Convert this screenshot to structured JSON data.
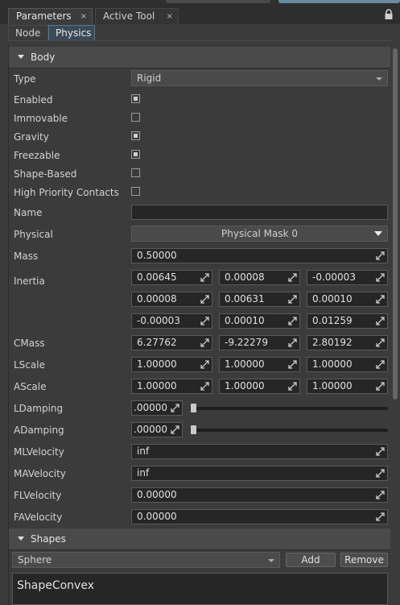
{
  "window": {
    "tabs": [
      {
        "label": "Parameters",
        "close": "×"
      },
      {
        "label": "Active Tool",
        "close": "×"
      }
    ],
    "lock_icon": "lock-icon"
  },
  "subtabs": [
    "Node",
    "Physics"
  ],
  "body_section": {
    "title": "Body",
    "type_label": "Type",
    "type_value": "Rigid",
    "checks": [
      {
        "label": "Enabled",
        "checked": true
      },
      {
        "label": "Immovable",
        "checked": false
      },
      {
        "label": "Gravity",
        "checked": true
      },
      {
        "label": "Freezable",
        "checked": true
      },
      {
        "label": "Shape-Based",
        "checked": false
      },
      {
        "label": "High Priority Contacts",
        "checked": false
      }
    ],
    "name_label": "Name",
    "name_value": "",
    "physical_label": "Physical",
    "physical_value": "Physical Mask 0",
    "mass_label": "Mass",
    "mass_value": "0.50000",
    "inertia_label": "Inertia",
    "inertia": [
      [
        "0.00645",
        "0.00008",
        "-0.00003"
      ],
      [
        "0.00008",
        "0.00631",
        "0.00010"
      ],
      [
        "-0.00003",
        "0.00010",
        "0.01259"
      ]
    ],
    "cmass_label": "CMass",
    "cmass": [
      "6.27762",
      "-9.22279",
      "2.80192"
    ],
    "lscale_label": "LScale",
    "lscale": [
      "1.00000",
      "1.00000",
      "1.00000"
    ],
    "ascale_label": "AScale",
    "ascale": [
      "1.00000",
      "1.00000",
      "1.00000"
    ],
    "ldamping_label": "LDamping",
    "ldamping_value": ".00000",
    "adamping_label": "ADamping",
    "adamping_value": ".00000",
    "mlvelocity_label": "MLVelocity",
    "mlvelocity_value": "inf",
    "mavelocity_label": "MAVelocity",
    "mavelocity_value": "inf",
    "flvelocity_label": "FLVelocity",
    "flvelocity_value": "0.00000",
    "favelocity_label": "FAVelocity",
    "favelocity_value": "0.00000"
  },
  "shapes_section": {
    "title": "Shapes",
    "shape_type": "Sphere",
    "add_label": "Add",
    "remove_label": "Remove",
    "list_items": [
      "ShapeConvex"
    ]
  }
}
